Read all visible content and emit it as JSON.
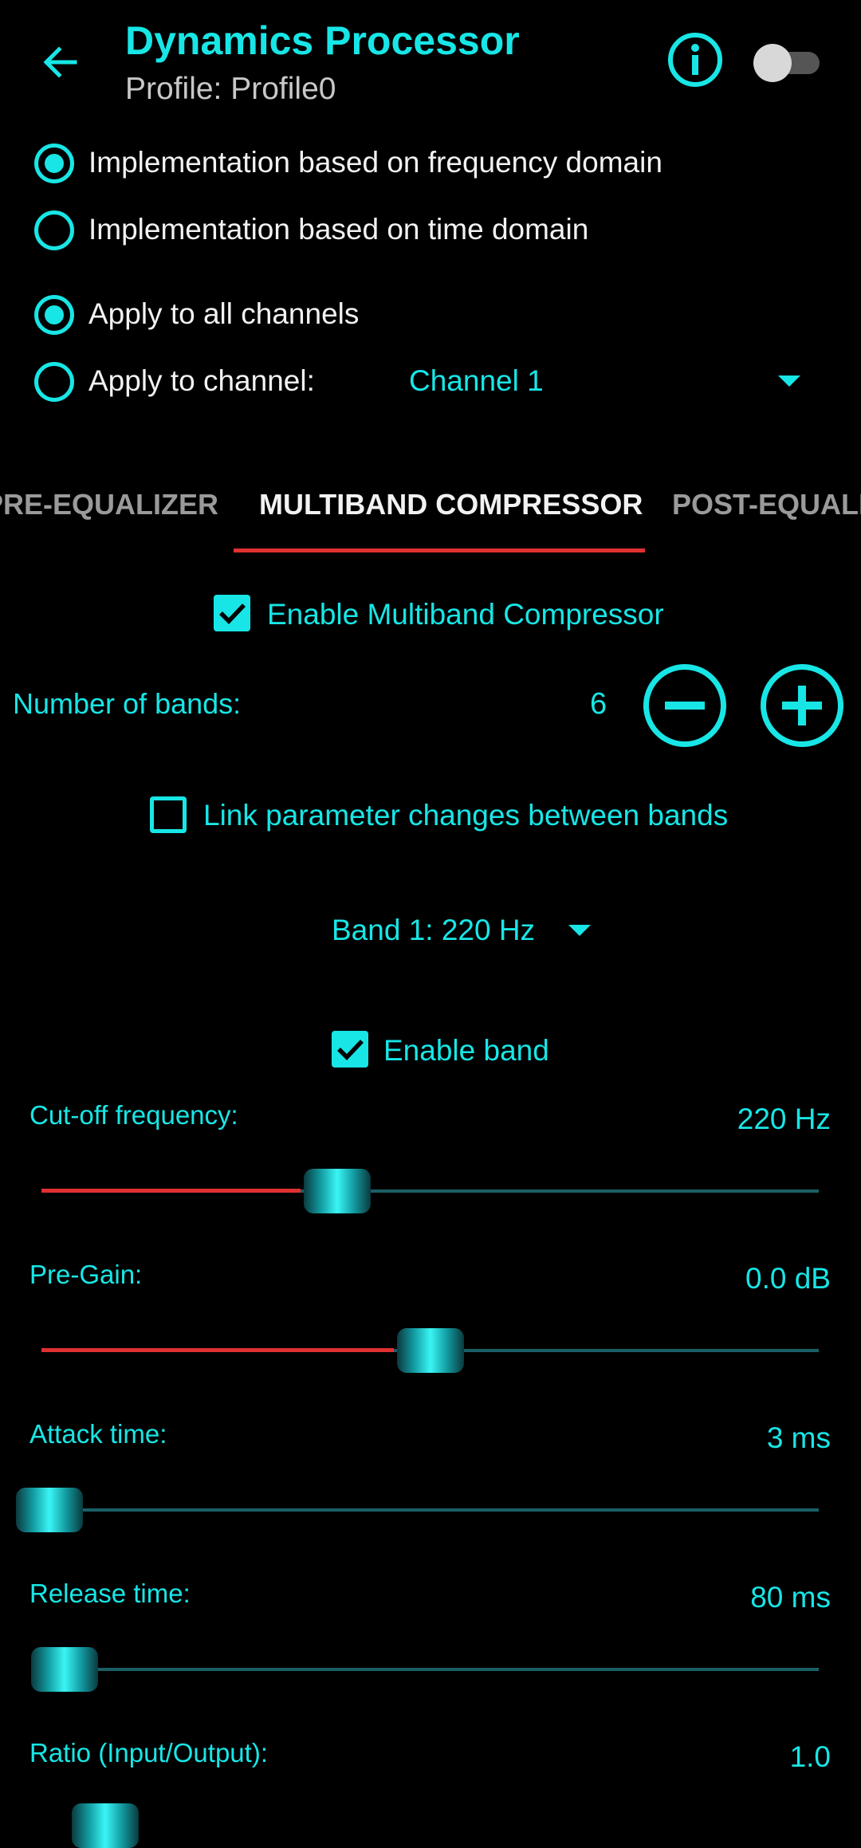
{
  "header": {
    "title": "Dynamics Processor",
    "subtitle": "Profile: Profile0",
    "back_icon": "back-arrow-icon",
    "info_icon": "info-icon",
    "enabled": false
  },
  "implementation": {
    "options": [
      {
        "label": "Implementation based on frequency domain",
        "checked": true
      },
      {
        "label": "Implementation based on time domain",
        "checked": false
      }
    ]
  },
  "channels": {
    "options": [
      {
        "label": "Apply to all channels",
        "checked": true
      },
      {
        "label": "Apply to channel:",
        "checked": false
      }
    ],
    "selected_channel": "Channel 1"
  },
  "tabs": [
    {
      "label": "PRE-EQUALIZER",
      "active": false
    },
    {
      "label": "MULTIBAND COMPRESSOR",
      "active": true
    },
    {
      "label": "POST-EQUALIZER",
      "active": false
    }
  ],
  "compressor": {
    "enable_label": "Enable Multiband Compressor",
    "enabled": true,
    "bands_label": "Number of bands:",
    "bands_value": "6",
    "link_label": "Link parameter changes between bands",
    "link_checked": false,
    "band_selected": "Band 1: 220 Hz",
    "enable_band_label": "Enable band",
    "enable_band_checked": true
  },
  "params": [
    {
      "label": "Cut-off frequency:",
      "value": "220 Hz",
      "level": 0.38,
      "fill": true
    },
    {
      "label": "Pre-Gain:",
      "value": "0.0 dB",
      "level": 0.5,
      "fill": true
    },
    {
      "label": "Attack time:",
      "value": "3 ms",
      "level": 0.0,
      "fill": false
    },
    {
      "label": "Release time:",
      "value": "80 ms",
      "level": 0.03,
      "fill": false
    },
    {
      "label": "Ratio (Input/Output):",
      "value": "1.0"
    }
  ],
  "colors": {
    "accent": "#18e6e6",
    "slider_fill": "#e03030",
    "tab_indicator": "#e03030",
    "background": "#000000"
  }
}
